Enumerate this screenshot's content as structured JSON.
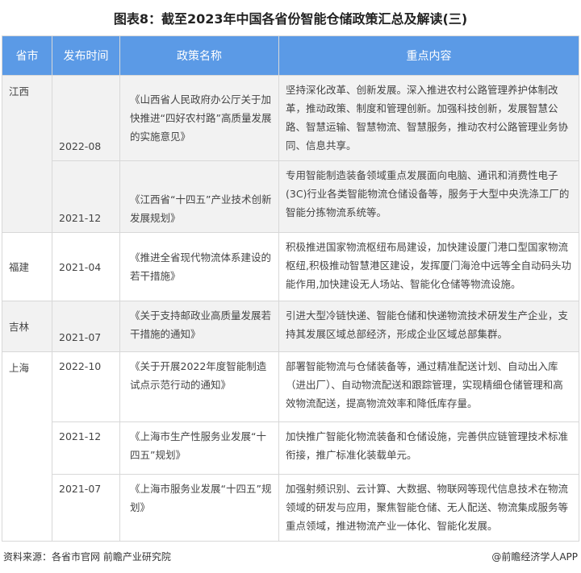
{
  "title": "图表8：截至2023年中国各省份智能仓储政策汇总及解读(三)",
  "headers": [
    "省市",
    "发布时间",
    "政策名称",
    "重点内容"
  ],
  "provinces": [
    "江西",
    "福建",
    "吉林",
    "上海"
  ],
  "rows": [
    {
      "date": "2022-08",
      "policy": "《山西省人民政府办公厅关于加快推进“四好农村路”高质量发展的实施意见》",
      "content": "坚持深化改革、创新发展。深入推进农村公路管理养护体制改革，推动政策、制度和管理创新。加强科技创新，发展智慧公路、智慧运输、智慧物流、智慧服务，推动农村公路管理业务协同、信息共享。"
    },
    {
      "date": "2021-12",
      "policy": "《江西省“十四五”产业技术创新发展规划》",
      "content": "专用智能制造装备领域重点发展面向电脑、通讯和消费性电子(3C)行业各类智能物流仓储设备等，服务于大型中央洗涤工厂的智能分拣物流系统等。"
    },
    {
      "date": "2021-04",
      "policy": "《推进全省现代物流体系建设的若干措施》",
      "content": "积极推进国家物流枢纽布局建设，加快建设厦门港口型国家物流枢纽,积极推动智慧港区建设，发挥厦门海沧中远等全自动码头功能作用,加快建设无人场站、智能化仓储等物流设施。"
    },
    {
      "date": "2021-07",
      "policy": "《关于支持邮政业高质量发展若干措施的通知》",
      "content": "引进大型冷链快递、智能仓储和快递物流技术研发生产企业，支持其发展区域总部经济，形成企业区域总部集群。"
    },
    {
      "date": "2022-10",
      "policy": "《关于开展2022年度智能制造试点示范行动的通知》",
      "content": "部署智能物流与仓储装备等，通过精准配送计划、自动出入库（进出厂）、自动物流配送和跟踪管理，实现精细仓储管理和高效物流配送，提高物流效率和降低库存量。"
    },
    {
      "date": "2021-12",
      "policy": "《上海市生产性服务业发展“十四五”规划》",
      "content": "加快推广智能化物流装备和仓储设施，完善供应链管理技术标准衔接，推广标准化装载单元。"
    },
    {
      "date": "2021-07",
      "policy": "《上海市服务业发展“十四五”规划》",
      "content": "加强射频识别、云计算、大数据、物联网等现代信息技术在物流领域的研发与应用，聚焦智能仓储、无人配送、物流集成服务等重点领域，推进物流产业一体化、智能化发展。"
    }
  ],
  "footer": {
    "source": "资料来源：各省市官网 前瞻产业研究院",
    "credit": "@前瞻经济学人APP"
  },
  "colors": {
    "header": "#5b9ae6",
    "alt_row": "#f2f2f2"
  }
}
